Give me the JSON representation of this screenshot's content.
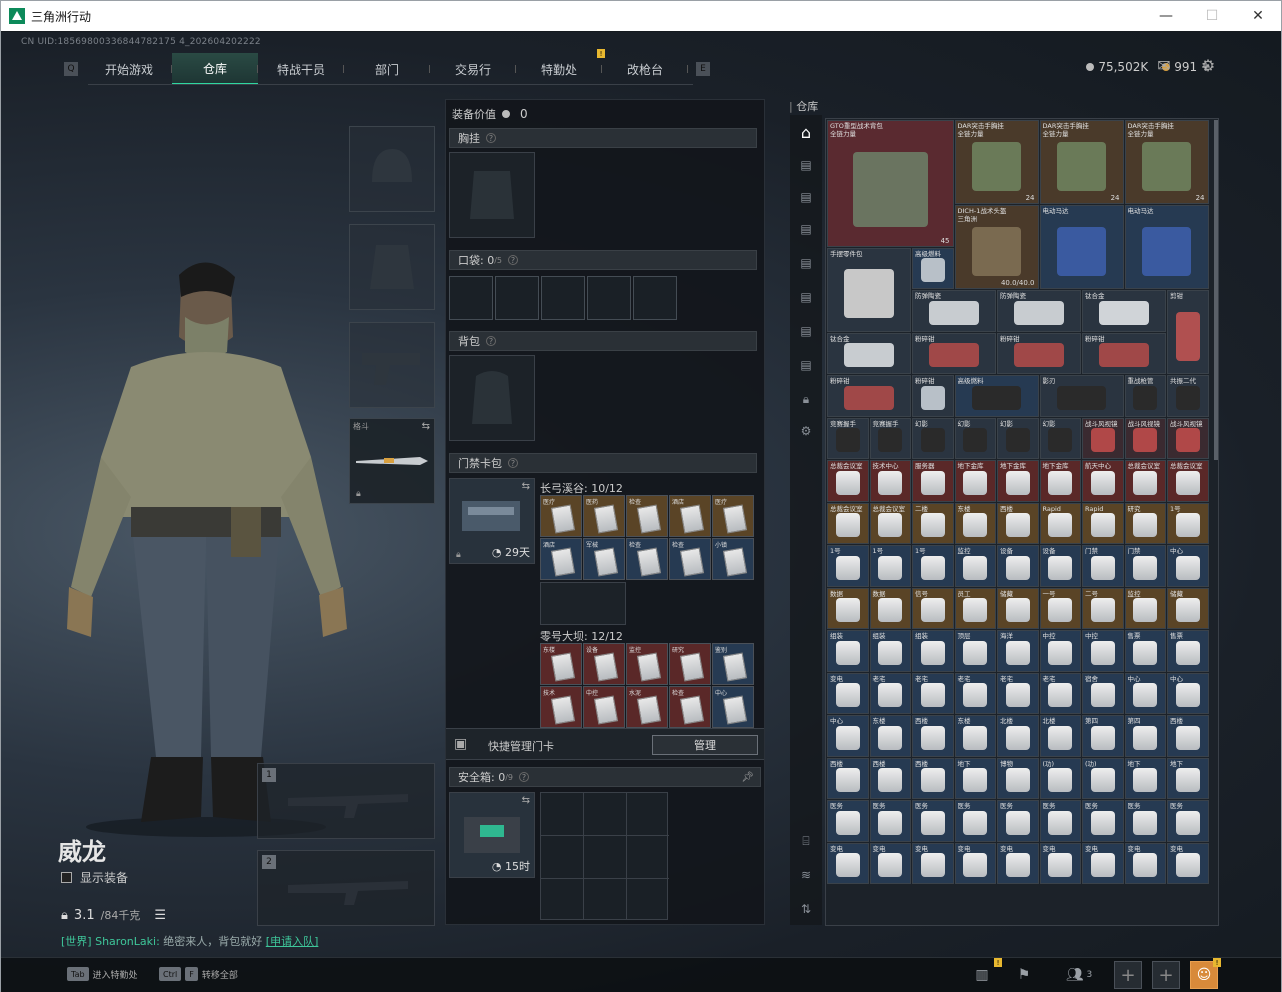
{
  "window": {
    "title": "三角洲行动",
    "minimize": "—",
    "maximize": "☐",
    "close": "✕"
  },
  "uid": "CN UID:18569800336844782175 4_202604202222",
  "nav": {
    "tabs": [
      "开始游戏",
      "仓库",
      "特战干员",
      "部门",
      "交易行",
      "特勤处",
      "改枪台"
    ],
    "active": 1,
    "badge": "!"
  },
  "currency": {
    "coins": "75,502K",
    "premium": "991",
    "plus": "+"
  },
  "character": {
    "name": "威龙",
    "show_equip": "显示装备",
    "weight": "3.1",
    "weight_max": "/84千克"
  },
  "chat": {
    "tag": "[世界]",
    "user": "SharonLaki:",
    "msg": "绝密来人，背包就好",
    "join": "[申请入队]"
  },
  "slots": {
    "melee_label": "格斗"
  },
  "middle": {
    "equip_value_label": "装备价值",
    "equip_value": "0",
    "vest": "胸挂",
    "pocket": "口袋:",
    "pocket_count": "0",
    "pocket_max": "/5",
    "backpack": "背包",
    "keycard": "门禁卡包",
    "keycard_timer": "29天",
    "zone1": "长弓溪谷:",
    "zone1_count": "10/12",
    "zone2": "零号大坝:",
    "zone2_count": "12/12",
    "quick_manage": "快捷管理门卡",
    "manage_btn": "管理",
    "safebox": "安全箱:",
    "safebox_count": "0",
    "safebox_max": "/9",
    "safebox_timer": "15时"
  },
  "zone1_cards": [
    {
      "t": "医疗",
      "c": "o"
    },
    {
      "t": "医药",
      "c": "o"
    },
    {
      "t": "检查",
      "c": "o"
    },
    {
      "t": "酒店",
      "c": "o"
    },
    {
      "t": "医疗",
      "c": "o"
    },
    {
      "t": "酒店",
      "c": "b"
    },
    {
      "t": "军械",
      "c": "b"
    },
    {
      "t": "检查",
      "c": "b"
    },
    {
      "t": "检查",
      "c": "b"
    },
    {
      "t": "小镇",
      "c": "b"
    }
  ],
  "zone2_cards": [
    {
      "t": "东楼",
      "c": "r"
    },
    {
      "t": "设备",
      "c": "r"
    },
    {
      "t": "监控",
      "c": "r"
    },
    {
      "t": "研究",
      "c": "r"
    },
    {
      "t": "鉴别",
      "c": "b"
    },
    {
      "t": "技术",
      "c": "r"
    },
    {
      "t": "中控",
      "c": "r"
    },
    {
      "t": "水泥",
      "c": "r"
    },
    {
      "t": "检查",
      "c": "r"
    },
    {
      "t": "中心",
      "c": "b"
    }
  ],
  "stash": {
    "title": "仓库",
    "items": [
      {
        "n": "GTO重型战术背包\n全链力量",
        "cnt": "45",
        "c": "#5a2a30"
      },
      {
        "n": "DAR突击手胸挂\n全链力量",
        "cnt": "24",
        "c": "#4a3a2a"
      },
      {
        "n": "DAR突击手胸挂\n全链力量",
        "cnt": "24",
        "c": "#4a3a2a"
      },
      {
        "n": "DAR突击手胸挂\n全链力量",
        "cnt": "24",
        "c": "#4a3a2a"
      },
      {
        "n": "DICH-1战术头盔\n三角洲",
        "cnt": "40.0/40.0",
        "c": "#4a3a2a"
      },
      {
        "n": "电动马达",
        "cnt": "",
        "c": "#263a52"
      },
      {
        "n": "电动马达",
        "cnt": "",
        "c": "#263a52"
      },
      {
        "n": "手摆零件包",
        "cnt": "",
        "c": "#2a3440"
      },
      {
        "n": "高级燃料",
        "cnt": "",
        "c": "#263a52"
      },
      {
        "n": "防弹陶瓷",
        "cnt": "",
        "c": "#2a3440"
      },
      {
        "n": "防弹陶瓷",
        "cnt": "",
        "c": "#2a3440"
      },
      {
        "n": "钛合金",
        "cnt": "",
        "c": "#2a3440"
      },
      {
        "n": "剪钳",
        "cnt": "",
        "c": "#2a3440"
      },
      {
        "n": "钛合金",
        "cnt": "",
        "c": "#2a3440"
      },
      {
        "n": "粉碎钳",
        "cnt": "",
        "c": "#2a3440"
      },
      {
        "n": "粉碎钳",
        "cnt": "",
        "c": "#2a3440"
      },
      {
        "n": "粉碎钳",
        "cnt": "",
        "c": "#2a3440"
      },
      {
        "n": "粉碎钳",
        "cnt": "",
        "c": "#2a3440"
      },
      {
        "n": "粉碎钳",
        "cnt": "",
        "c": "#2a3440"
      },
      {
        "n": "高级燃料",
        "cnt": "",
        "c": "#263a52"
      },
      {
        "n": "影刃",
        "cnt": "",
        "c": "#2a3440"
      },
      {
        "n": "重战枪管",
        "cnt": "",
        "c": "#2a3440"
      },
      {
        "n": "共振二代",
        "cnt": "",
        "c": "#2a3440"
      },
      {
        "n": "共振二代",
        "cnt": "",
        "c": "#2a3440"
      }
    ],
    "small_items": [
      "竞赛握手",
      "竞赛握手",
      "幻影",
      "幻影",
      "幻影",
      "幻影",
      "战斗风视镜",
      "战斗风视镜",
      "战斗风视镜"
    ],
    "card_rows": [
      [
        "总裁会议室",
        "技术中心",
        "服务器",
        "地下金库",
        "地下金库",
        "地下金库",
        "航天中心",
        "总裁会议室",
        "总裁会议室"
      ],
      [
        "总裁会议室",
        "总裁会议室",
        "二楼",
        "东楼",
        "西楼",
        "Rapid",
        "Rapid",
        "研究",
        "1号"
      ],
      [
        "1号",
        "1号",
        "1号",
        "监控",
        "设备",
        "设备",
        "门禁",
        "门禁",
        "中心"
      ],
      [
        "数据",
        "数据",
        "信号",
        "员工",
        "储藏",
        "一号",
        "二号",
        "监控",
        "储藏"
      ],
      [
        "组装",
        "组装",
        "组装",
        "顶层",
        "海洋",
        "中控",
        "中控",
        "售票",
        "售票"
      ],
      [
        "变电",
        "老宅",
        "老宅",
        "老宅",
        "老宅",
        "老宅",
        "宿舍",
        "中心",
        "中心"
      ],
      [
        "中心",
        "东楼",
        "西楼",
        "东楼",
        "北楼",
        "北楼",
        "第四",
        "第四",
        "西楼"
      ],
      [
        "西楼",
        "西楼",
        "西楼",
        "地下",
        "博物",
        "(功)",
        "(功)",
        "地下",
        "地下"
      ],
      [
        "医务",
        "医务",
        "医务",
        "医务",
        "医务",
        "医务",
        "医务",
        "医务",
        "医务"
      ],
      [
        "变电",
        "变电",
        "变电",
        "变电",
        "变电",
        "变电",
        "变电",
        "变电",
        "变电"
      ]
    ],
    "card_row_colors": [
      "r",
      "o",
      "b",
      "o",
      "b",
      "b",
      "b",
      "b",
      "b",
      "b"
    ]
  },
  "bottom": {
    "tab_key": "Tab",
    "tab_label": "进入特勤处",
    "ctrl_key": "Ctrl",
    "f_key": "F",
    "ctrl_label": "转移全部",
    "team_count": "3"
  }
}
